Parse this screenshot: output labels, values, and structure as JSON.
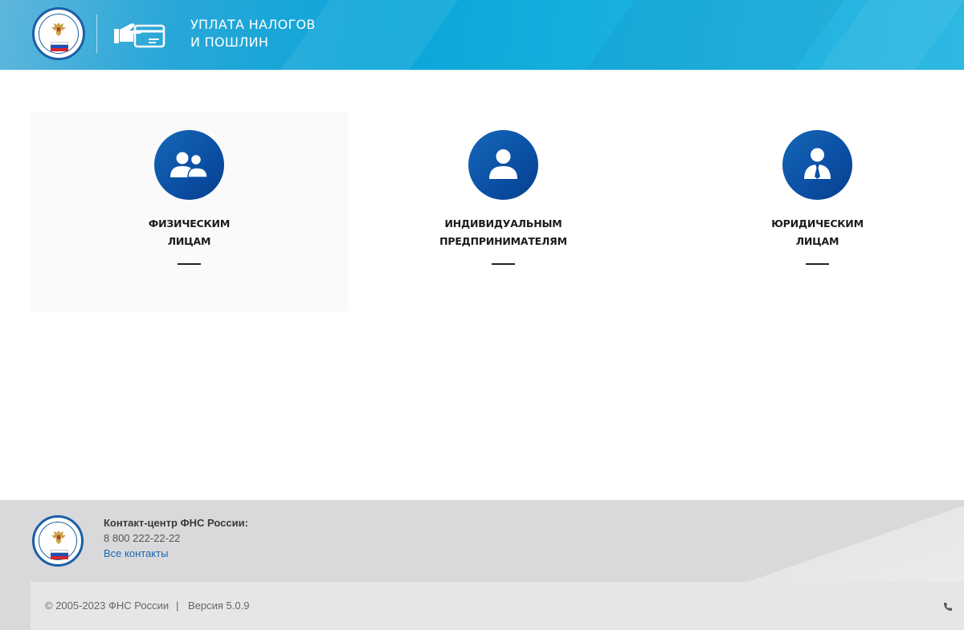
{
  "header": {
    "title_line1": "УПЛАТА НАЛОГОВ",
    "title_line2": "И ПОШЛИН",
    "logo_icon": "fns-emblem-icon",
    "pay_icon": "hand-card-icon"
  },
  "cards": [
    {
      "line1": "ФИЗИЧЕСКИМ",
      "line2": "ЛИЦАМ",
      "icon": "users-group-icon"
    },
    {
      "line1": "ИНДИВИДУАЛЬНЫМ",
      "line2": "ПРЕДПРИНИМАТЕЛЯМ",
      "icon": "user-icon"
    },
    {
      "line1": "ЮРИДИЧЕСКИМ",
      "line2": "ЛИЦАМ",
      "icon": "businessman-icon"
    }
  ],
  "footer": {
    "contact_label": "Контакт-центр ФНС России:",
    "phone": "8 800 222-22-22",
    "contacts_link": "Все контакты",
    "copyright": "© 2005-2023 ФНС России",
    "separator": "|",
    "version": "Версия 5.0.9",
    "phone_icon": "phone-icon"
  },
  "colors": {
    "header_blue": "#0aa6d8",
    "circle_blue": "#0a4fa3",
    "link_blue": "#1a68b0",
    "footer_gray": "#d9d9db"
  }
}
